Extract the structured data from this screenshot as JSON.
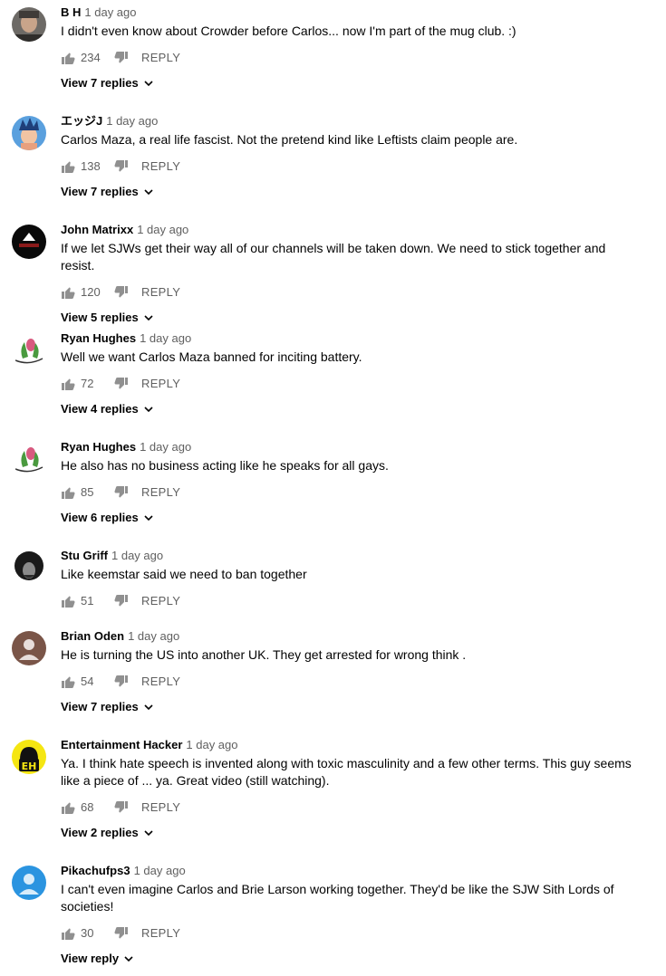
{
  "comments": [
    {
      "author": "B H",
      "time": "1 day ago",
      "text": "I didn't even know about Crowder before Carlos... now I'm part of the mug club. :)",
      "likes": "234",
      "reply": "REPLY",
      "view": "View 7 replies"
    },
    {
      "author": "エッジJ",
      "time": "1 day ago",
      "text": "Carlos Maza, a real life fascist. Not the pretend kind like Leftists claim people are.",
      "likes": "138",
      "reply": "REPLY",
      "view": "View 7 replies"
    },
    {
      "author": "John Matrixx",
      "time": "1 day ago",
      "text": "If we let SJWs get their way all of our channels will be taken down. We need to stick together and resist.",
      "likes": "120",
      "reply": "REPLY",
      "view": "View 5 replies"
    },
    {
      "author": "Ryan Hughes",
      "time": "1 day ago",
      "text": "Well we want Carlos Maza banned for inciting battery.",
      "likes": "72",
      "reply": "REPLY",
      "view": "View 4 replies"
    },
    {
      "author": "Ryan Hughes",
      "time": "1 day ago",
      "text": "He also has no business acting like he speaks for all gays.",
      "likes": "85",
      "reply": "REPLY",
      "view": "View 6 replies"
    },
    {
      "author": "Stu Griff",
      "time": "1 day ago",
      "text": "Like keemstar said we need to ban together",
      "likes": "51",
      "reply": "REPLY",
      "view": ""
    },
    {
      "author": "Brian Oden",
      "time": "1 day ago",
      "text": "He is turning the US into another UK. They get arrested for wrong think .",
      "likes": "54",
      "reply": "REPLY",
      "view": "View 7 replies"
    },
    {
      "author": "Entertainment Hacker",
      "time": "1 day ago",
      "text": "Ya. I think hate speech is invented along with toxic masculinity and a few other terms. This guy seems like a piece of ... ya. Great video (still watching).",
      "likes": "68",
      "reply": "REPLY",
      "view": "View 2 replies"
    },
    {
      "author": "Pikachufps3",
      "time": "1 day ago",
      "text": "I can't even imagine Carlos and Brie Larson working together. They'd be like the SJW Sith Lords of societies!",
      "likes": "30",
      "reply": "REPLY",
      "view": "View reply"
    }
  ],
  "avatar_logo_text": "EH",
  "colors": {
    "secondary_text": "#606060",
    "primary_text": "#030303",
    "icon": "#909090"
  }
}
